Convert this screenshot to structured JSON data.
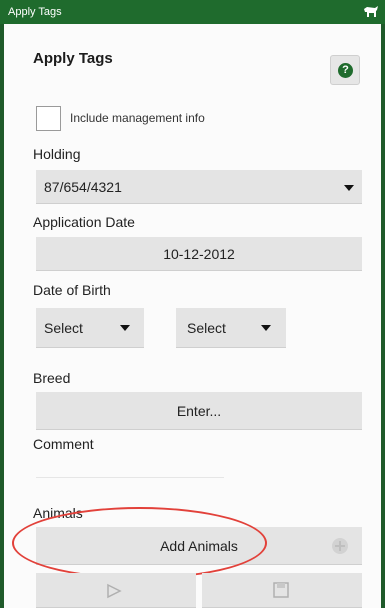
{
  "titlebar": {
    "title": "Apply Tags",
    "icon": "cow-icon"
  },
  "form": {
    "heading": "Apply Tags",
    "help_icon": "?",
    "management_checkbox_label": "Include management info",
    "management_checked": false,
    "holding_label": "Holding",
    "holding_value": "87/654/4321",
    "application_date_label": "Application Date",
    "application_date_value": "10-12-2012",
    "dob_label": "Date of Birth",
    "dob_day_value": "Select",
    "dob_month_value": "Select",
    "breed_label": "Breed",
    "breed_button": "Enter...",
    "comment_label": "Comment",
    "comment_value": "",
    "animals_label": "Animals",
    "add_animals_button": "Add Animals"
  },
  "colors": {
    "titlebar": "#1f6b2d",
    "highlight_ring": "#e2413a"
  }
}
